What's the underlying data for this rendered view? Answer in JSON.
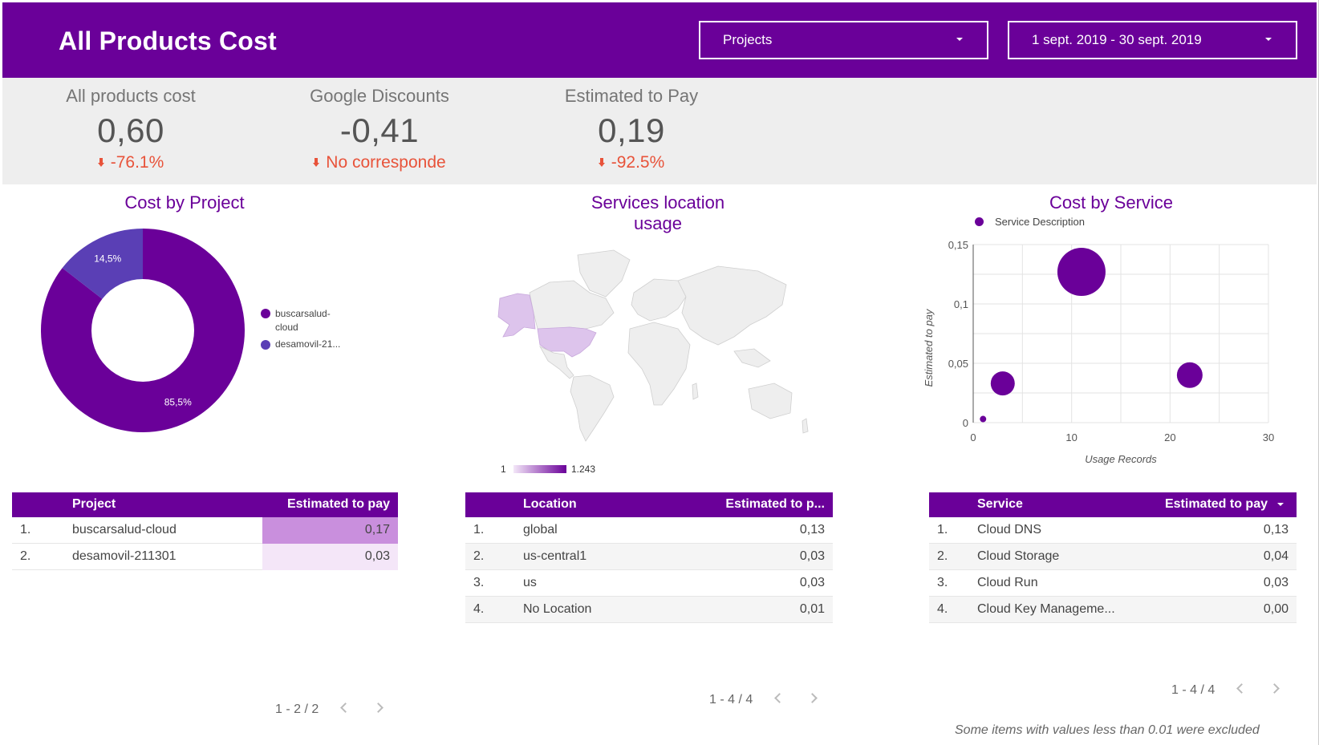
{
  "header": {
    "title": "All Products Cost",
    "project_filter": "Projects",
    "date_filter": "1 sept. 2019 - 30 sept. 2019"
  },
  "kpis": [
    {
      "label": "All products cost",
      "value": "0,60",
      "delta": "-76.1%"
    },
    {
      "label": "Google Discounts",
      "value": "-0,41",
      "delta": "No corresponde"
    },
    {
      "label": "Estimated to Pay",
      "value": "0,19",
      "delta": "-92.5%"
    }
  ],
  "colors": {
    "brand": "#6a0099",
    "secondary": "#5a3fb5",
    "negative": "#e8533a"
  },
  "cost_by_project": {
    "title": "Cost by Project",
    "legend": [
      "buscarsalud-\ncloud",
      "desamovil-21..."
    ],
    "chart_data": {
      "type": "pie",
      "categories": [
        "buscarsalud-cloud",
        "desamovil-211301"
      ],
      "values": [
        85.5,
        14.5
      ],
      "labels": [
        "85,5%",
        "14,5%"
      ]
    },
    "table": {
      "headers": [
        "Project",
        "Estimated to pay"
      ],
      "rows": [
        {
          "index": "1.",
          "name": "buscarsalud-cloud",
          "value": "0,17",
          "ratio": 1.0
        },
        {
          "index": "2.",
          "name": "desamovil-211301",
          "value": "0,03",
          "ratio": 0.18
        }
      ],
      "pager": "1 - 2 / 2"
    }
  },
  "location_usage": {
    "title_line1": "Services location",
    "title_line2": "usage",
    "scale_min": "1",
    "scale_max": "1.243",
    "table": {
      "headers": [
        "Location",
        "Estimated to p..."
      ],
      "rows": [
        {
          "index": "1.",
          "name": "global",
          "value": "0,13"
        },
        {
          "index": "2.",
          "name": "us-central1",
          "value": "0,03"
        },
        {
          "index": "3.",
          "name": "us",
          "value": "0,03"
        },
        {
          "index": "4.",
          "name": "No Location",
          "value": "0,01"
        }
      ],
      "pager": "1 - 4 / 4"
    }
  },
  "cost_by_service": {
    "title": "Cost by Service",
    "chart_data": {
      "type": "scatter",
      "legend": "Service Description",
      "xlabel": "Usage Records",
      "ylabel": "Estimated to pay",
      "xlim": [
        0,
        30
      ],
      "ylim": [
        0,
        0.15
      ],
      "xticks": [
        "0",
        "10",
        "20",
        "30"
      ],
      "yticks": [
        "0",
        "0,05",
        "0,1",
        "0,15"
      ],
      "points": [
        {
          "x": 11,
          "y": 0.127,
          "size": 30
        },
        {
          "x": 3,
          "y": 0.033,
          "size": 15
        },
        {
          "x": 22,
          "y": 0.04,
          "size": 16
        },
        {
          "x": 1,
          "y": 0.003,
          "size": 4
        }
      ]
    },
    "table": {
      "headers": [
        "Service",
        "Estimated to pay"
      ],
      "rows": [
        {
          "index": "1.",
          "name": "Cloud DNS",
          "value": "0,13"
        },
        {
          "index": "2.",
          "name": "Cloud Storage",
          "value": "0,04"
        },
        {
          "index": "3.",
          "name": "Cloud Run",
          "value": "0,03"
        },
        {
          "index": "4.",
          "name": "Cloud Key Manageme...",
          "value": "0,00"
        }
      ],
      "pager": "1 - 4 / 4"
    }
  },
  "footnote": "Some items with values less than 0.01 were excluded"
}
